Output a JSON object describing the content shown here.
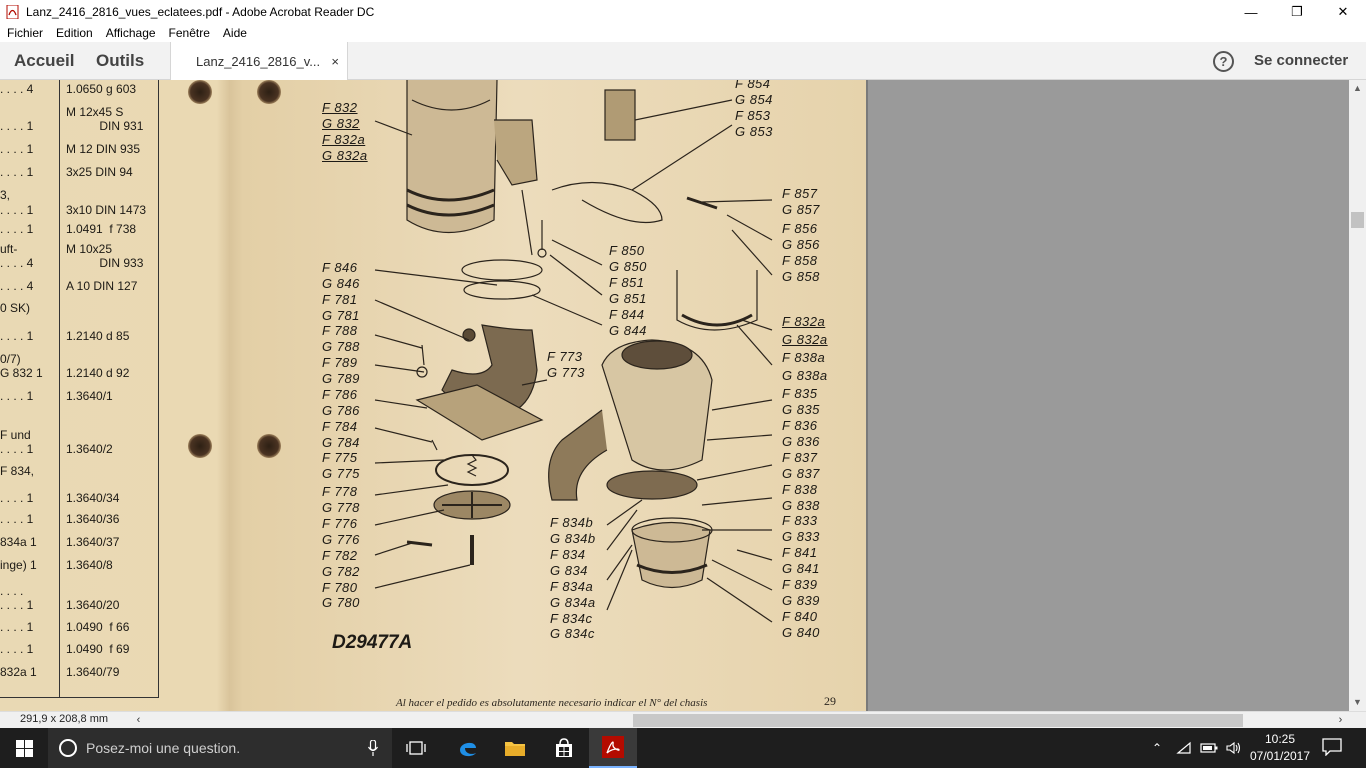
{
  "window": {
    "title": "Lanz_2416_2816_vues_eclatees.pdf - Adobe Acrobat Reader DC",
    "minimize": "—",
    "maximize": "❐",
    "close": "✕"
  },
  "menu": [
    "Fichier",
    "Edition",
    "Affichage",
    "Fenêtre",
    "Aide"
  ],
  "tabs": {
    "home": "Accueil",
    "tools": "Outils",
    "document": "Lanz_2416_2816_v...",
    "close": "×",
    "help": "?",
    "signin": "Se connecter"
  },
  "parts_table": [
    {
      "a": ". . . .   4",
      "b": "1.0650 g 603"
    },
    {
      "a": ". . . .   1",
      "b": "M 12x45 S\n          DIN 931"
    },
    {
      "a": ". . . .   1",
      "b": "M 12 DIN 935"
    },
    {
      "a": ". . . .   1",
      "b": "3x25 DIN 94"
    },
    {
      "a": "3,",
      "b": ""
    },
    {
      "a": ". . . .   1",
      "b": "3x10 DIN 1473"
    },
    {
      "a": ". . . .   1",
      "b": "1.0491  f 738"
    },
    {
      "a": "uft-",
      "b": "M 10x25"
    },
    {
      "a": ". . . .   4",
      "b": "          DIN 933"
    },
    {
      "a": ". . . .   4",
      "b": "A 10 DIN 127"
    },
    {
      "a": "0 SK)",
      "b": ""
    },
    {
      "a": ". . . .   1",
      "b": "1.2140 d 85"
    },
    {
      "a": "0/7)",
      "b": ""
    },
    {
      "a": "G 832   1",
      "b": "1.2140 d 92"
    },
    {
      "a": ". . . .   1",
      "b": "1.3640/1"
    },
    {
      "a": "F und",
      "b": ""
    },
    {
      "a": ". . . .   1",
      "b": "1.3640/2"
    },
    {
      "a": "F 834,",
      "b": ""
    },
    {
      "a": ". . . .   1",
      "b": "1.3640/34"
    },
    {
      "a": ". . . .   1",
      "b": "1.3640/36"
    },
    {
      "a": "834a    1",
      "b": "1.3640/37"
    },
    {
      "a": "inge)   1",
      "b": "1.3640/8"
    },
    {
      "a": ". . . .",
      "b": ""
    },
    {
      "a": ". . . .   1",
      "b": "1.3640/20"
    },
    {
      "a": ". . . .   1",
      "b": "1.0490  f 66"
    },
    {
      "a": ". . . .   1",
      "b": "1.0490  f 69"
    },
    {
      "a": "832a    1",
      "b": "1.3640/79"
    }
  ],
  "labels_left": [
    "F 846",
    "G 846",
    "F 781",
    "G 781",
    "F 788",
    "G 788",
    "F 789",
    "G 789",
    "F 786",
    "G 786",
    "F 784",
    "G 784",
    "F 775",
    "G 775",
    "F 778",
    "G 778",
    "F 776",
    "G 776",
    "F 782",
    "G 782",
    "F 780",
    "G 780"
  ],
  "labels_top_left": [
    "F 832",
    "G 832",
    "F 832a",
    "G 832a"
  ],
  "labels_mid": [
    "F 850",
    "G 850",
    "F 851",
    "G 851",
    "F 844",
    "G 844"
  ],
  "labels_center": [
    "F 773",
    "G 773"
  ],
  "labels_bottom_center": [
    "F 834b",
    "G 834b",
    "F 834",
    "G 834",
    "F 834a",
    "G 834a",
    "F 834c",
    "G 834c"
  ],
  "labels_top_right": [
    "F 854",
    "G 854",
    "F 853",
    "G 853"
  ],
  "labels_right": [
    "F 857",
    "G 857",
    "F 856",
    "G 856",
    "F 858",
    "G 858"
  ],
  "labels_right2": [
    "F 832a",
    "G 832a",
    "F 838a",
    "G 838a"
  ],
  "labels_right3": [
    "F 835",
    "G 835",
    "F 836",
    "G 836",
    "F 837",
    "G 837",
    "F 838",
    "G 838",
    "F 833",
    "G 833",
    "F 841",
    "G 841",
    "F 839",
    "G 839",
    "F 840",
    "G 840"
  ],
  "drawing_ref": "D29477A",
  "footer": "Al hacer el pedido es absolutamente necesario indicar el N° del chasis",
  "page_number": "29",
  "status": {
    "dimensions": "291,9 x 208,8 mm"
  },
  "taskbar": {
    "search_placeholder": "Posez-moi une question.",
    "time": "10:25",
    "date": "07/01/2017"
  }
}
